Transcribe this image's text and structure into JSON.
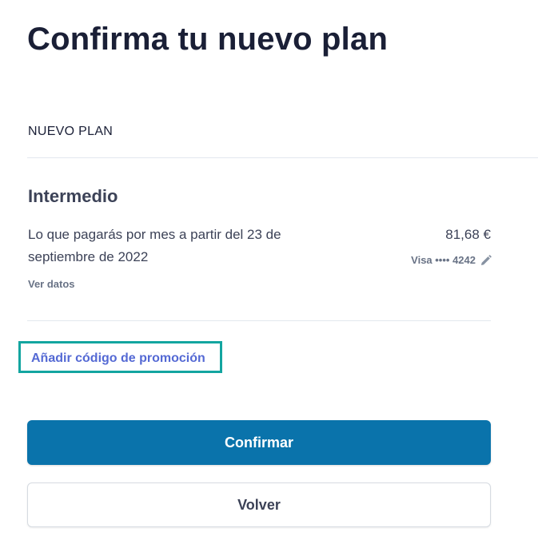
{
  "page": {
    "title": "Confirma tu nuevo plan"
  },
  "plan": {
    "section_label": "NUEVO PLAN",
    "name": "Intermedio",
    "description": "Lo que pagarás por mes a partir del 23 de septiembre de 2022",
    "price": "81,68 €",
    "payment_method": "Visa •••• 4242",
    "payment_edit_icon": "pencil-icon",
    "see_details": "Ver datos"
  },
  "promo": {
    "link_label": "Añadir código de promoción",
    "highlight_color": "#13a5a0"
  },
  "actions": {
    "confirm_label": "Confirmar",
    "back_label": "Volver",
    "confirm_color": "#0a73ab"
  }
}
